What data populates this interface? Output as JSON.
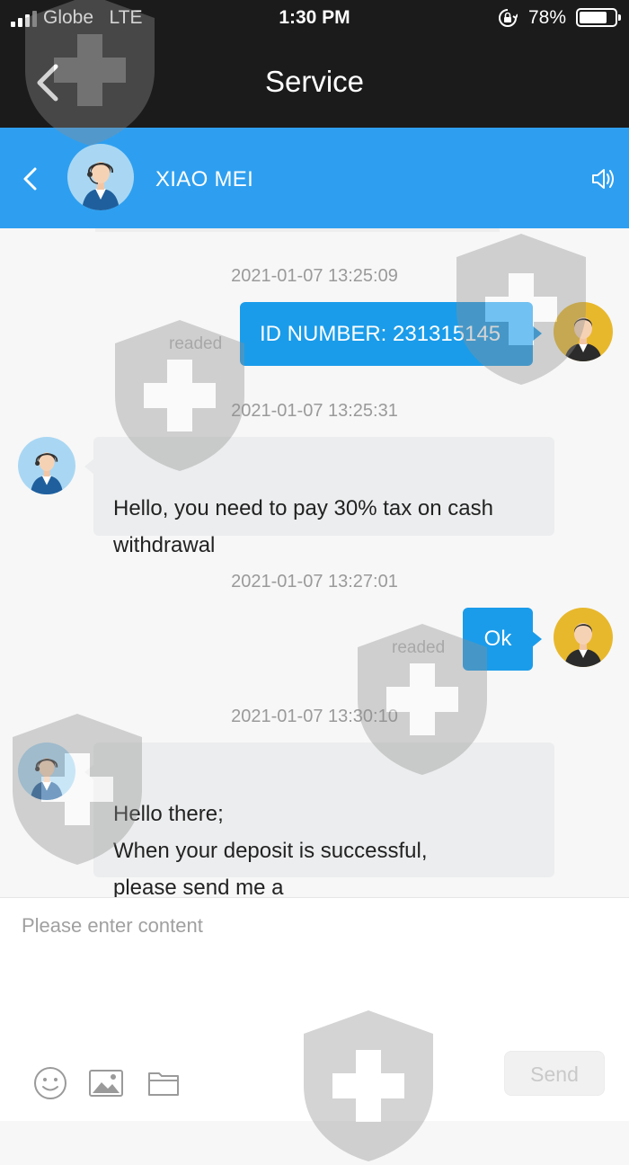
{
  "status_bar": {
    "carrier": "Globe   LTE",
    "time": "1:30 PM",
    "battery": "78%",
    "battery_level": 0.78
  },
  "nav": {
    "title": "Service"
  },
  "chat_header": {
    "name": "XIAO MEI"
  },
  "messages": [
    {
      "timestamp": "2021-01-07 13:25:09",
      "direction": "out",
      "text": "ID NUMBER: 231315145",
      "receipt": "readed"
    },
    {
      "timestamp": "2021-01-07 13:25:31",
      "direction": "in",
      "text": "Hello, you need to pay 30% tax on cash withdrawal"
    },
    {
      "timestamp": "2021-01-07 13:27:01",
      "direction": "out",
      "text": "Ok",
      "receipt": "readed"
    },
    {
      "timestamp": "2021-01-07 13:30:10",
      "direction": "in",
      "text": "Hello there;\nWhen your deposit is successful,\nplease send me a"
    }
  ],
  "composer": {
    "placeholder": "Please enter content",
    "send_label": "Send"
  },
  "colors": {
    "header_blue": "#2e9ff0",
    "bubble_blue": "#1a9cea",
    "bar_dark": "#1b1b1b"
  }
}
